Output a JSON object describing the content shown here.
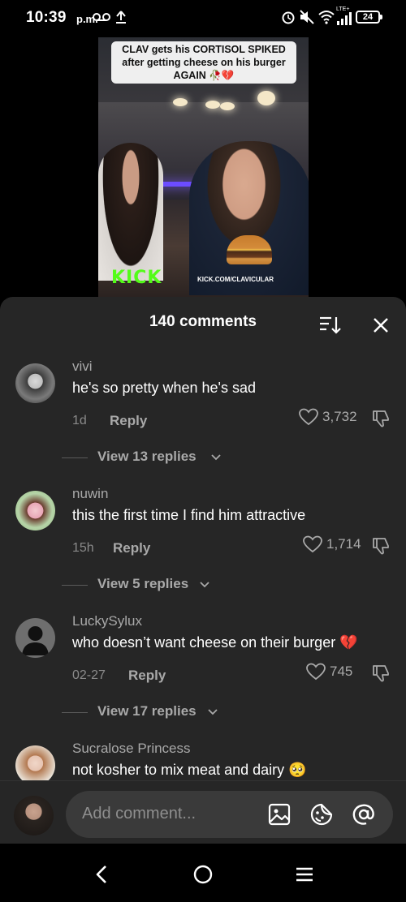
{
  "status": {
    "time": "10:39",
    "ampm": "p.m.",
    "network_label": "LTE+",
    "battery": "24"
  },
  "video": {
    "caption": "CLAV gets his CORTISOL SPIKED after getting cheese on his burger AGAIN 🥀💔",
    "logo": "KICK",
    "url": "KICK.COM/CLAVICULAR"
  },
  "sheet": {
    "title": "140 comments"
  },
  "comments": [
    {
      "user": "vivi",
      "text": "he's so pretty when he's sad",
      "time": "1d",
      "reply_label": "Reply",
      "likes": "3,732",
      "view_replies": "View 13 replies"
    },
    {
      "user": "nuwin",
      "text": "this the first time I find him attractive",
      "time": "15h",
      "reply_label": "Reply",
      "likes": "1,714",
      "view_replies": "View 5 replies"
    },
    {
      "user": "LuckySylux",
      "text": "who doesn’t want cheese on their burger 💔",
      "time": "02-27",
      "reply_label": "Reply",
      "likes": "745",
      "view_replies": "View 17 replies"
    },
    {
      "user": "Sucralose Princess",
      "text": "not kosher to mix meat and dairy 🥺"
    }
  ],
  "input": {
    "placeholder": "Add comment..."
  },
  "colors": {
    "sheet_bg": "#262626",
    "secondary_text": "#a9a9a9",
    "kick_green": "#53fc18",
    "heartbreak_red": "#e0245e"
  }
}
